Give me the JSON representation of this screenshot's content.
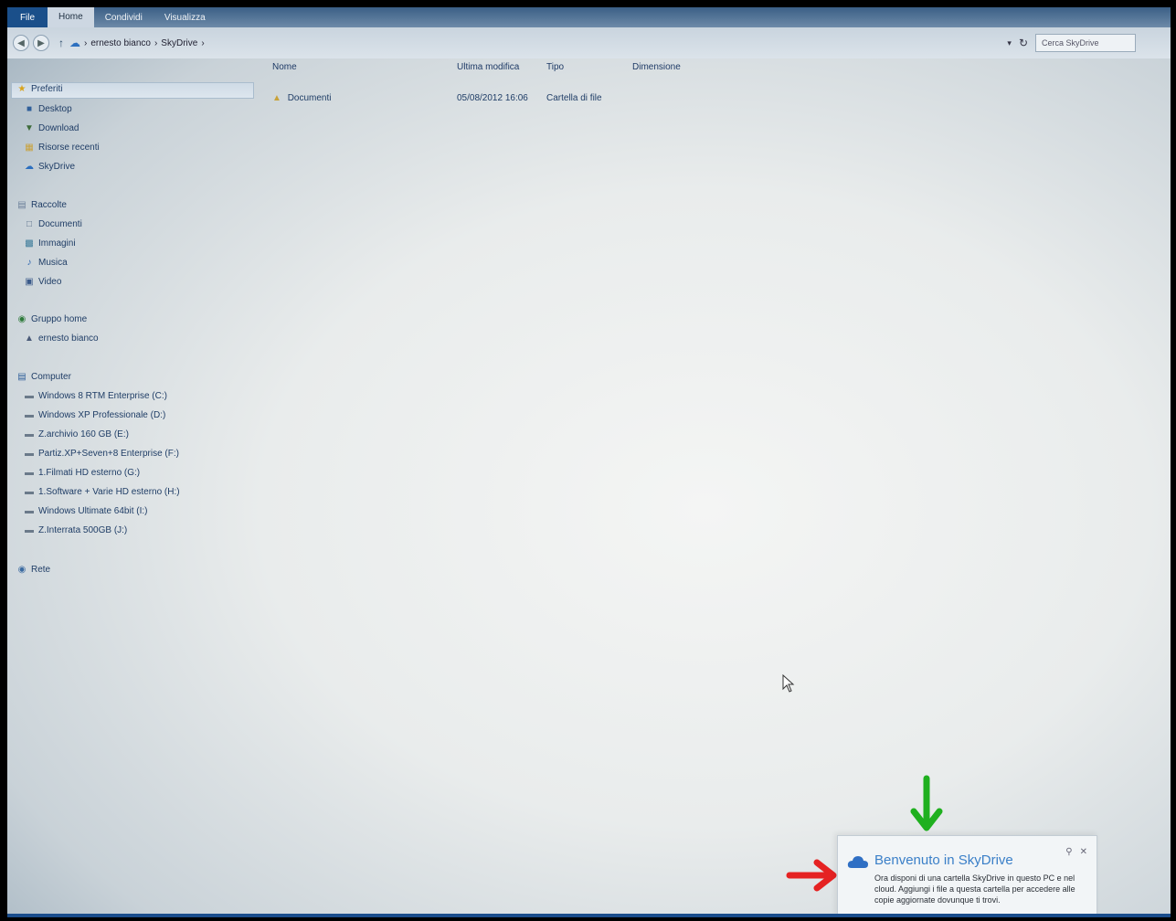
{
  "ribbon": {
    "file_tab": "File",
    "tabs": [
      "Home",
      "Condividi",
      "Visualizza"
    ]
  },
  "address": {
    "breadcrumb": [
      "ernesto bianco",
      "SkyDrive"
    ],
    "search_placeholder": "Cerca SkyDrive"
  },
  "columns": {
    "name": "Nome",
    "modified": "Ultima modifica",
    "type": "Tipo",
    "size": "Dimensione"
  },
  "sidebar": {
    "favorites": {
      "label": "Preferiti",
      "items": [
        "Desktop",
        "Download",
        "Risorse recenti",
        "SkyDrive"
      ]
    },
    "libraries": {
      "label": "Raccolte",
      "items": [
        "Documenti",
        "Immagini",
        "Musica",
        "Video"
      ]
    },
    "homegroup": {
      "label": "Gruppo home",
      "items": [
        "ernesto bianco"
      ]
    },
    "computer": {
      "label": "Computer",
      "items": [
        "Windows 8 RTM Enterprise (C:)",
        "Windows XP Professionale (D:)",
        "Z.archivio 160 GB (E:)",
        "Partiz.XP+Seven+8 Enterprise (F:)",
        "1.Filmati HD esterno (G:)",
        "1.Software + Varie HD esterno (H:)",
        "Windows Ultimate 64bit (I:)",
        "Z.Interrata 500GB (J:)"
      ]
    },
    "network": {
      "label": "Rete"
    }
  },
  "files": [
    {
      "name": "Documenti",
      "modified": "05/08/2012 16:06",
      "type": "Cartella di file",
      "size": ""
    }
  ],
  "toast": {
    "title": "Benvenuto in SkyDrive",
    "body": "Ora disponi di una cartella SkyDrive in questo PC e nel cloud. Aggiungi i file a questa cartella per accedere alle copie aggiornate dovunque ti trovi.",
    "icon": "skydrive-cloud-icon"
  },
  "colors": {
    "ribbon": "#3b5f86",
    "link_text": "#1f3d66",
    "toast_title": "#3a7fc8",
    "red_arrow": "#e52222",
    "green_arrow": "#1fb01f"
  }
}
